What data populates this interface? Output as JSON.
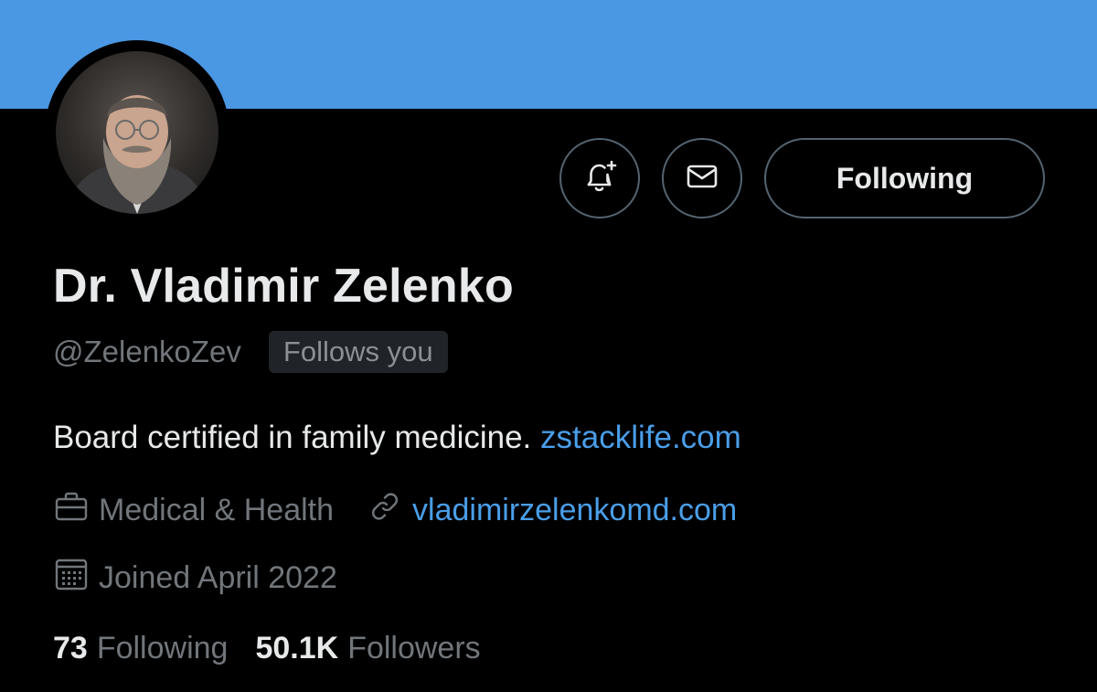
{
  "profile": {
    "display_name": "Dr. Vladimir Zelenko",
    "handle": "@ZelenkoZev",
    "follows_you_badge": "Follows you",
    "bio_text": "Board certified in family medicine.",
    "bio_link": "zstacklife.com",
    "category": "Medical & Health",
    "website": "vladimirzelenkomd.com",
    "joined": "Joined April 2022"
  },
  "actions": {
    "notify_icon": "bell-plus-icon",
    "message_icon": "envelope-icon",
    "follow_label": "Following"
  },
  "stats": {
    "following_count": "73",
    "following_label": "Following",
    "followers_count": "50.1K",
    "followers_label": "Followers"
  },
  "colors": {
    "banner": "#4a97e3",
    "background": "#000000",
    "link": "#4a9ee8",
    "secondary_text": "#71767b"
  }
}
